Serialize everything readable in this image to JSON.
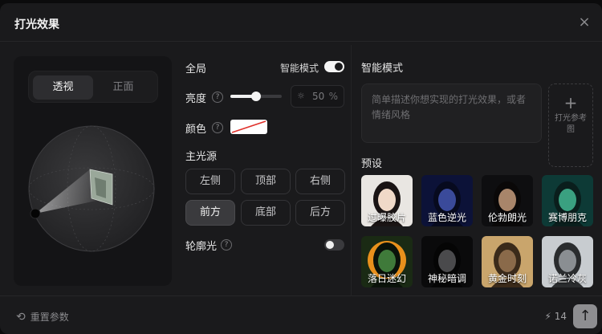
{
  "dialog": {
    "title": "打光效果",
    "close_icon": "×"
  },
  "view_toggle": {
    "perspective_label": "透视",
    "front_label": "正面",
    "selected": "透视"
  },
  "global": {
    "label": "全局",
    "smart_mode_label": "智能模式",
    "smart_mode_on": true,
    "brightness_label": "亮度",
    "brightness_value": "50",
    "brightness_unit": "%",
    "brightness_level": 0.5,
    "color_label": "颜色",
    "color_value": "#ffffff"
  },
  "light_source": {
    "label": "主光源",
    "positions": [
      "左侧",
      "顶部",
      "右侧",
      "前方",
      "底部",
      "后方"
    ],
    "selected": "前方"
  },
  "rim_light": {
    "label": "轮廓光",
    "on": false
  },
  "smart_mode_panel": {
    "title": "智能模式",
    "prompt_placeholder": "简单描述你想实现的打光效果，或者情绪风格",
    "reference_label": "打光参考图",
    "reference_icon": "+"
  },
  "presets": {
    "title": "预设",
    "items": [
      {
        "label": "过曝胶片",
        "bg": "#e9e6e2",
        "face": "#f0d9c8",
        "hair": "#1a1414"
      },
      {
        "label": "蓝色逆光",
        "bg": "#0c1238",
        "face": "#3a4a9a",
        "hair": "#070a1e"
      },
      {
        "label": "伦勃朗光",
        "bg": "#0e0e10",
        "face": "#a8856a",
        "hair": "#0a0808"
      },
      {
        "label": "赛博朋克",
        "bg": "#0d3a36",
        "face": "#3aa080",
        "hair": "#0a1e1c"
      },
      {
        "label": "落日迷幻",
        "bg": "#1a2a14",
        "face": "#3f7a3a",
        "hair": "#0a120a",
        "sun": "#e8901c"
      },
      {
        "label": "神秘暗调",
        "bg": "#0a0a0b",
        "face": "#4a4a4c",
        "hair": "#050505"
      },
      {
        "label": "黄金时刻",
        "bg": "#c9a56c",
        "face": "#8a6a4a",
        "hair": "#3a2a1a"
      },
      {
        "label": "诺兰冷灰",
        "bg": "#c8ccd0",
        "face": "#8a8e92",
        "hair": "#2a2c2e"
      }
    ]
  },
  "footer": {
    "reset_label": "重置参数",
    "reset_icon": "⟲",
    "credits_icon": "⚡",
    "credits": "14",
    "submit_icon": "↑"
  }
}
